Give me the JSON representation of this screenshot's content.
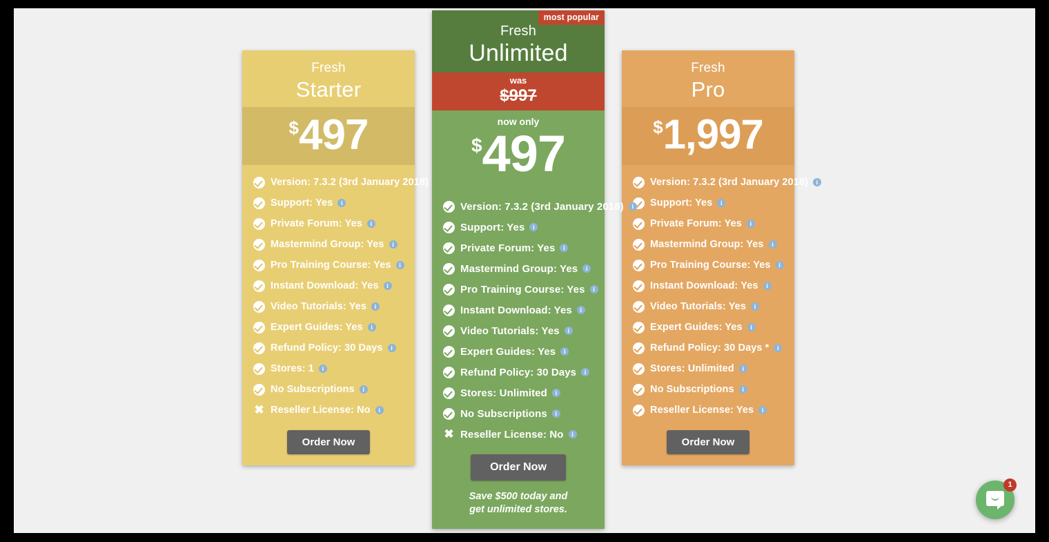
{
  "page": {
    "background": "#f0f0f0",
    "accent_yellow": "#e8ce73",
    "accent_green": "#7ba75f",
    "accent_orange": "#e3a762",
    "accent_red": "#c0472f",
    "button_color": "#616161"
  },
  "plans": [
    {
      "id": "starter",
      "brand": "Fresh",
      "name": "Starter",
      "currency": "$",
      "price": "497",
      "order_label": "Order Now",
      "features": [
        {
          "icon": "check-icon",
          "label": "Version: 7.3.2 (3rd January 2018)",
          "info": "info-icon"
        },
        {
          "icon": "check-icon",
          "label": "Support: Yes",
          "info": "info-icon"
        },
        {
          "icon": "check-icon",
          "label": "Private Forum: Yes",
          "info": "info-icon"
        },
        {
          "icon": "check-icon",
          "label": "Mastermind Group: Yes",
          "info": "info-icon"
        },
        {
          "icon": "check-icon",
          "label": "Pro Training Course: Yes",
          "info": "info-icon"
        },
        {
          "icon": "check-icon",
          "label": "Instant Download: Yes",
          "info": "info-icon"
        },
        {
          "icon": "check-icon",
          "label": "Video Tutorials: Yes",
          "info": "info-icon"
        },
        {
          "icon": "check-icon",
          "label": "Expert Guides: Yes",
          "info": "info-icon"
        },
        {
          "icon": "check-icon",
          "label": "Refund Policy: 30 Days",
          "info": "info-icon"
        },
        {
          "icon": "check-icon",
          "label": "Stores: 1",
          "info": "info-icon"
        },
        {
          "icon": "check-icon",
          "label": "No Subscriptions",
          "info": "info-icon"
        },
        {
          "icon": "cross-icon",
          "label": "Reseller License: No",
          "info": "info-icon"
        }
      ]
    },
    {
      "id": "unlimited",
      "ribbon": "most popular",
      "brand": "Fresh",
      "name": "Unlimited",
      "was_label": "was",
      "was_price": "$997",
      "now_label": "now only",
      "currency": "$",
      "price": "497",
      "order_label": "Order Now",
      "promo_line1": "Save $500 today and",
      "promo_line2": "get unlimited stores.",
      "features": [
        {
          "icon": "check-icon",
          "label": "Version: 7.3.2 (3rd January 2018)",
          "info": "info-icon"
        },
        {
          "icon": "check-icon",
          "label": "Support: Yes",
          "info": "info-icon"
        },
        {
          "icon": "check-icon",
          "label": "Private Forum: Yes",
          "info": "info-icon"
        },
        {
          "icon": "check-icon",
          "label": "Mastermind Group: Yes",
          "info": "info-icon"
        },
        {
          "icon": "check-icon",
          "label": "Pro Training Course: Yes",
          "info": "info-icon"
        },
        {
          "icon": "check-icon",
          "label": "Instant Download: Yes",
          "info": "info-icon"
        },
        {
          "icon": "check-icon",
          "label": "Video Tutorials: Yes",
          "info": "info-icon"
        },
        {
          "icon": "check-icon",
          "label": "Expert Guides: Yes",
          "info": "info-icon"
        },
        {
          "icon": "check-icon",
          "label": "Refund Policy: 30 Days",
          "info": "info-icon"
        },
        {
          "icon": "check-icon",
          "label": "Stores: Unlimited",
          "info": "info-icon"
        },
        {
          "icon": "check-icon",
          "label": "No Subscriptions",
          "info": "info-icon"
        },
        {
          "icon": "cross-icon",
          "label": "Reseller License: No",
          "info": "info-icon"
        }
      ]
    },
    {
      "id": "pro",
      "brand": "Fresh",
      "name": "Pro",
      "currency": "$",
      "price": "1,997",
      "order_label": "Order Now",
      "features": [
        {
          "icon": "check-icon",
          "label": "Version: 7.3.2 (3rd January 2018)",
          "info": "info-icon"
        },
        {
          "icon": "check-icon",
          "label": "Support: Yes",
          "info": "info-icon"
        },
        {
          "icon": "check-icon",
          "label": "Private Forum: Yes",
          "info": "info-icon"
        },
        {
          "icon": "check-icon",
          "label": "Mastermind Group: Yes",
          "info": "info-icon"
        },
        {
          "icon": "check-icon",
          "label": "Pro Training Course: Yes",
          "info": "info-icon"
        },
        {
          "icon": "check-icon",
          "label": "Instant Download: Yes",
          "info": "info-icon"
        },
        {
          "icon": "check-icon",
          "label": "Video Tutorials: Yes",
          "info": "info-icon"
        },
        {
          "icon": "check-icon",
          "label": "Expert Guides: Yes",
          "info": "info-icon"
        },
        {
          "icon": "check-icon",
          "label": "Refund Policy: 30 Days *",
          "info": "info-icon"
        },
        {
          "icon": "check-icon",
          "label": "Stores: Unlimited",
          "info": "info-icon"
        },
        {
          "icon": "check-icon",
          "label": "No Subscriptions",
          "info": "info-icon"
        },
        {
          "icon": "check-icon",
          "label": "Reseller License: Yes",
          "info": "info-icon"
        }
      ]
    }
  ],
  "chat": {
    "icon": "chat-bubble-icon",
    "unread_count": "1",
    "color": "#6cb56c",
    "badge_color": "#c0392b"
  }
}
